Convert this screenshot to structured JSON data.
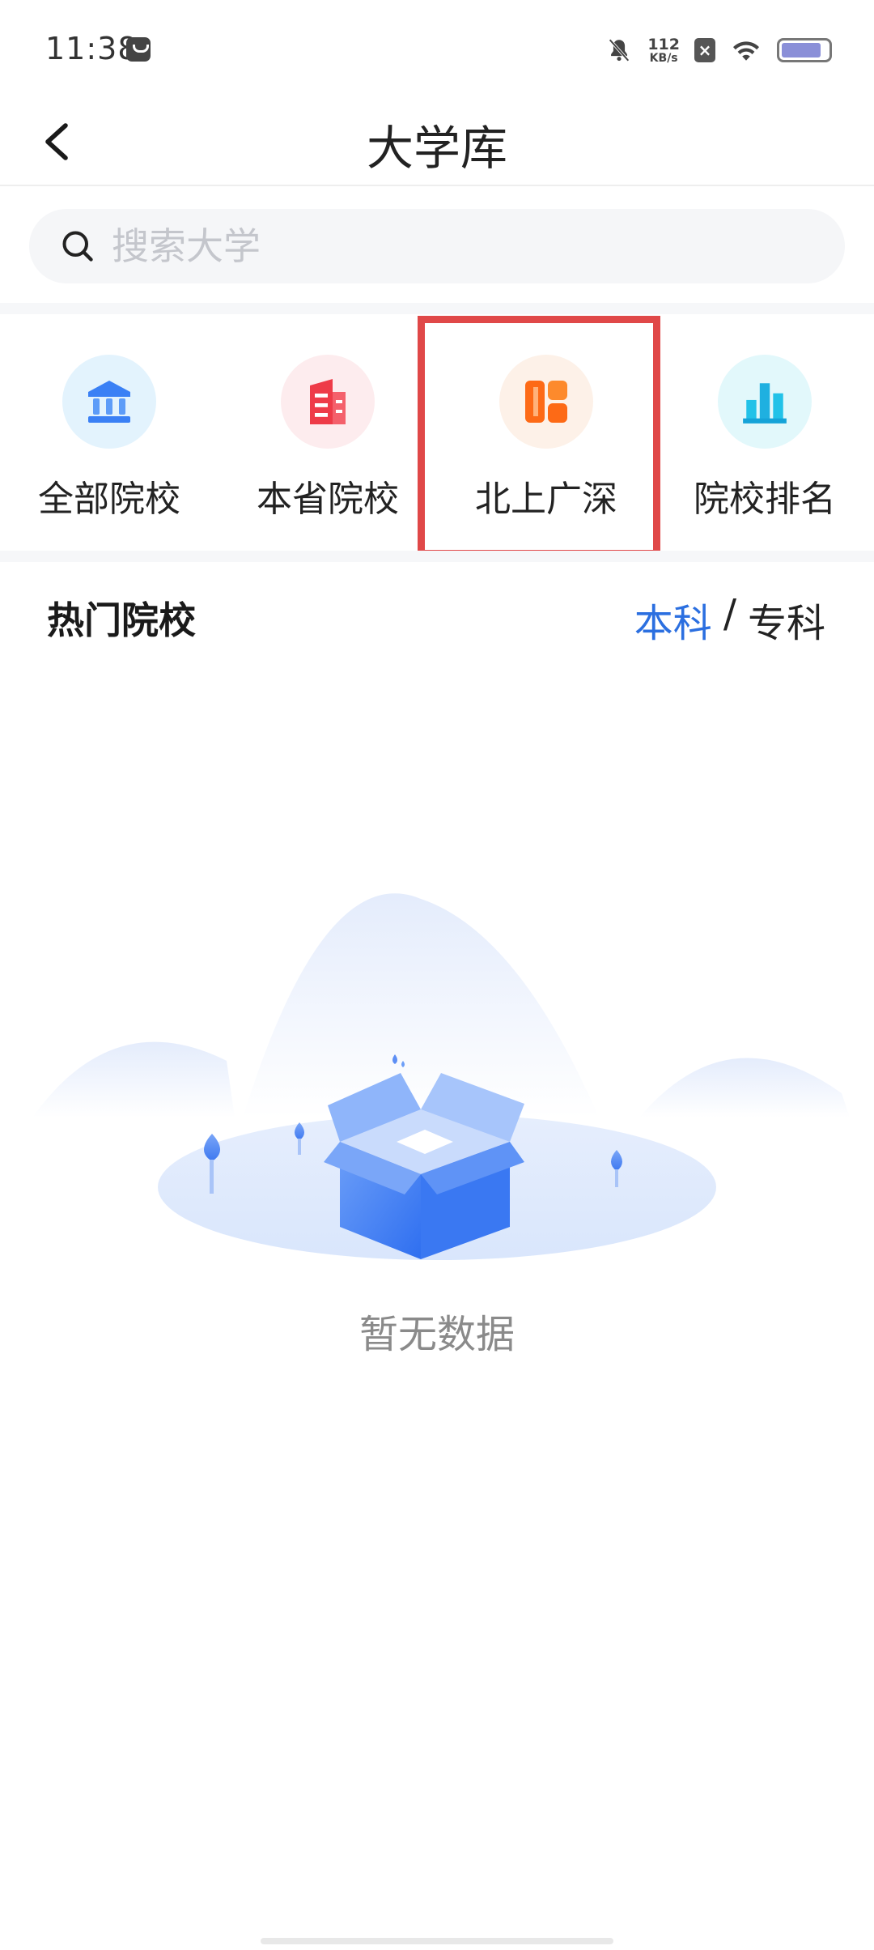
{
  "status_bar": {
    "time": "11:38",
    "net_speed_value": "112",
    "net_speed_unit": "KB/s",
    "sim_label": "×",
    "battery_level": 0.85
  },
  "header": {
    "title": "大学库"
  },
  "search": {
    "placeholder": "搜索大学"
  },
  "categories": [
    {
      "label": "全部院校",
      "icon": "university-building-icon",
      "bg": "#e3f3fd",
      "color": "#3a80f5"
    },
    {
      "label": "本省院校",
      "icon": "office-building-icon",
      "bg": "#fdecee",
      "color": "#ee3b48"
    },
    {
      "label": "北上广深",
      "icon": "city-grid-icon",
      "bg": "#fdf1e8",
      "color": "#fd7a1c"
    },
    {
      "label": "院校排名",
      "icon": "bar-chart-icon",
      "bg": "#e2f8fb",
      "color": "#22c2e8"
    }
  ],
  "section": {
    "title": "热门院校",
    "tab_active": "本科",
    "tab_separator": "/",
    "tab_inactive": "专科"
  },
  "empty_state": {
    "message": "暂无数据"
  },
  "colors": {
    "accent": "#2b6fe0",
    "highlight": "#e04848"
  }
}
